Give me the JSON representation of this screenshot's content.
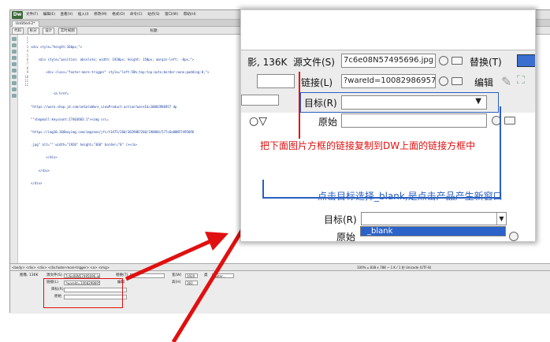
{
  "app": {
    "logo": "Dw",
    "menus": [
      "文件(F)",
      "编辑(E)",
      "查看(V)",
      "插入(I)",
      "修改(M)",
      "格式(O)",
      "命令(C)",
      "站点(S)",
      "窗口(W)",
      "帮助(H)"
    ],
    "doc_tab": "Untitled-2*",
    "view_buttons": [
      "代码",
      "拆分",
      "设计",
      "实时视图"
    ],
    "title_label": "标题:"
  },
  "code": {
    "line_numbers": [
      "1",
      "2",
      "3",
      "4",
      "5",
      "6",
      "7",
      "8",
      "9",
      "10",
      "11",
      "12"
    ],
    "lines": [
      "<div style=\"height:160px;\">",
      "    <div style=\"position: absolute; width: 1920px; height: 150px; margin-left: -0px;\">",
      "        <div class=\"footer-more-trigger\" style=\"left:50%;top:top:auto;border:none;padding:0;\">",
      "",
      "            <a href=",
      "\"https://ware.shop.jd.com/onSaleWare_viewProduct.action?wareId=10082986957 dp",
      "\"\"shopmall:keycount:27403603:1\"><img src=",
      "\"https://img10.360buyimg.com/imgzone/jfs/t3475/260/3029807260/198884/577c6e08N57495696",
      ".jpg\" alt=\"\" width=\"1920\" height=\"360\" border=\"0\" /></a>",
      "        </div>",
      "    </div>",
      "</div>"
    ]
  },
  "status": {
    "tag_path": "<body> <div> <div> <div.footer-more-trigger> <a> <img>",
    "right": "100%   ⌂   838 x 788 ~  1 K / 1 秒  Unicode (UTF-8)"
  },
  "props": {
    "image_label": "图像, 136K",
    "src_label": "源文件(S)",
    "src_value": "7c6e08N57495696.jpg",
    "alt_label": "替换(T)",
    "w_label": "宽(W)",
    "w_value": "1920",
    "h_label": "高(H)",
    "h_value": "360",
    "link_label": "链接(L)",
    "link_value": "?wareId=10082986957",
    "edit_label": "编辑",
    "target_label": "目标(R)",
    "orig_label": "原始",
    "class_label": "类",
    "class_value": "footer..."
  },
  "inset": {
    "size_text": "影, 136K",
    "src_label": "源文件(S)",
    "src_value": "7c6e08N57495696.jpg",
    "alt_label": "替换(T)",
    "link_label": "链接(L)",
    "link_value": "?wareId=10082986957",
    "edit_label": "编辑",
    "target_label": "目标(R)",
    "orig_label": "原始",
    "instruction_red": "把下面图片方框的链接复制到DW上面的链接方框中",
    "instruction_blue": "点击目标选择_blank,是点击产品产生新窗口",
    "dd_target_label": "目标(R)",
    "dd_orig_label": "原始",
    "dd_option": "_blank"
  },
  "colors": {
    "annotation_red": "#e01010",
    "annotation_blue": "#2a5fc0",
    "selection_blue": "#2b63c8"
  }
}
